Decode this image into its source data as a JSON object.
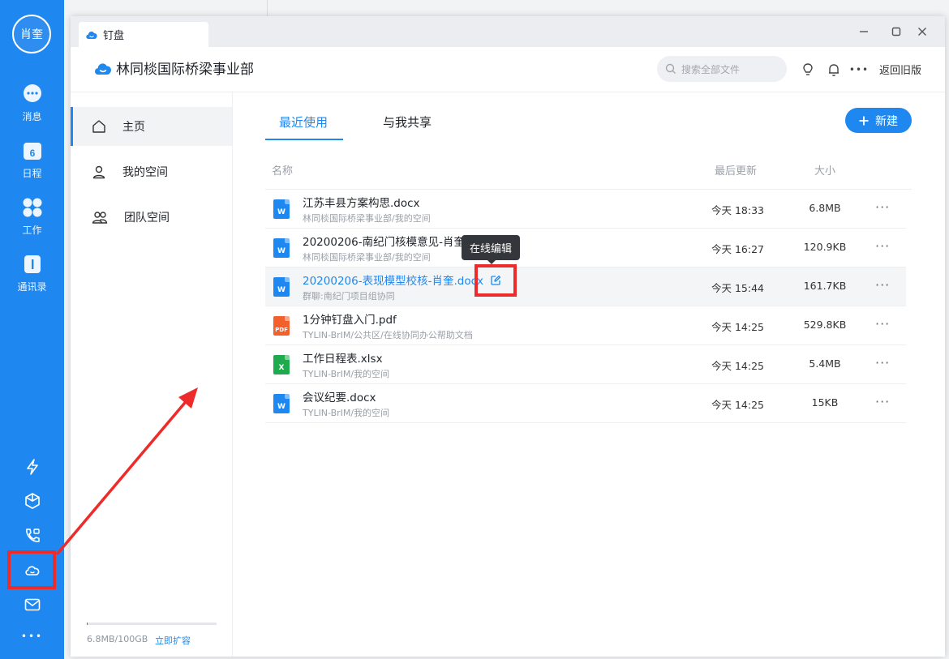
{
  "rail": {
    "avatar_text": "肖奎",
    "items": [
      {
        "label": "消息",
        "icon": "chat-icon"
      },
      {
        "label": "日程",
        "icon": "calendar-icon",
        "badge": "6"
      },
      {
        "label": "工作",
        "icon": "apps-icon"
      },
      {
        "label": "通讯录",
        "icon": "contacts-icon"
      }
    ],
    "bottom_icons": [
      "lightning-icon",
      "cube-icon",
      "phone-video-icon",
      "cloud-icon",
      "mail-icon",
      "more-icon"
    ],
    "more_label": "•••"
  },
  "window": {
    "tab_title": "钉盘",
    "org_name": "林同棪国际桥梁事业部",
    "search_placeholder": "搜索全部文件",
    "back_old": "返回旧版",
    "more_label": "•••"
  },
  "sidebar": {
    "items": [
      {
        "label": "主页",
        "icon": "home-icon"
      },
      {
        "label": "我的空间",
        "icon": "user-icon"
      },
      {
        "label": "团队空间",
        "icon": "team-icon"
      }
    ],
    "quota_used_fraction": 7e-05,
    "quota_text": "6.8MB/100GB",
    "quota_link": "立即扩容"
  },
  "main": {
    "tabs": [
      "最近使用",
      "与我共享"
    ],
    "new_button": "新建",
    "columns": {
      "name": "名称",
      "updated": "最后更新",
      "size": "大小"
    },
    "files": [
      {
        "name": "江苏丰县方案构思.docx",
        "path": "林同棪国际桥梁事业部/我的空间",
        "updated": "今天 18:33",
        "size": "6.8MB",
        "type": "W",
        "color": "#1e88f0"
      },
      {
        "name": "20200206-南纪门核模意见-肖奎.docx",
        "path": "林同棪国际桥梁事业部/我的空间",
        "updated": "今天 16:27",
        "size": "120.9KB",
        "type": "W",
        "color": "#1e88f0"
      },
      {
        "name": "20200206-表现模型校核-肖奎.docx",
        "path": "群聊:南纪门项目组协同",
        "updated": "今天 15:44",
        "size": "161.7KB",
        "type": "W",
        "color": "#1e88f0"
      },
      {
        "name": "1分钟钉盘入门.pdf",
        "path": "TYLIN-BrIM/公共区/在线协同办公帮助文档",
        "updated": "今天 14:25",
        "size": "529.8KB",
        "type": "PDF",
        "color": "#f4602c"
      },
      {
        "name": "工作日程表.xlsx",
        "path": "TYLIN-BrIM/我的空间",
        "updated": "今天 14:25",
        "size": "5.4MB",
        "type": "X",
        "color": "#1faa4e"
      },
      {
        "name": "会议纪要.docx",
        "path": "TYLIN-BrIM/我的空间",
        "updated": "今天 14:25",
        "size": "15KB",
        "type": "W",
        "color": "#1e88f0"
      }
    ],
    "row_more": "···",
    "tooltip": "在线编辑"
  },
  "colors": {
    "accent": "#1e88f0",
    "highlight": "#ee2b2b"
  }
}
